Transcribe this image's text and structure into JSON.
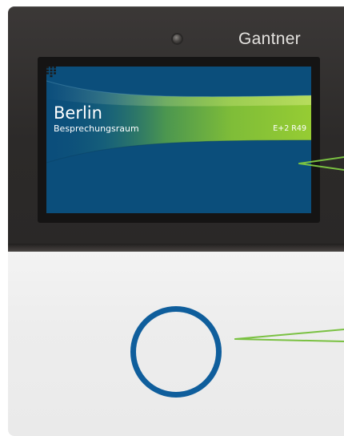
{
  "device": {
    "brand": "Gantner",
    "screen": {
      "title": "Berlin",
      "subtitle": "Besprechungsraum",
      "room_code": "E+2 R49"
    },
    "icons": {
      "keypad": "keypad-icon",
      "camera": "camera-icon",
      "reader": "rfid-reader-ring"
    }
  },
  "colors": {
    "screen_background": "#0b4e7b",
    "accent_green": "#8cc63f",
    "ring_blue": "#0f5e9c",
    "bezel": "#2e2c2b",
    "panel": "#eeeeee",
    "callout_green": "#7ac142"
  }
}
